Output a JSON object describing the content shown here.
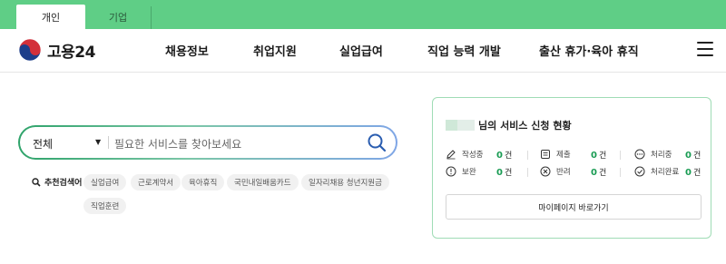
{
  "top_tabs": [
    {
      "label": "개인",
      "active": true
    },
    {
      "label": "기업",
      "active": false
    }
  ],
  "header": {
    "logo_text": "고용24",
    "nav": [
      "채용정보",
      "취업지원",
      "실업급여",
      "직업 능력 개발",
      "출산 휴가·육아 휴직"
    ],
    "menu_icon": "hamburger-icon"
  },
  "search": {
    "category": "전체",
    "placeholder": "필요한 서비스를 찾아보세요",
    "icon": "search-icon"
  },
  "recommended": {
    "label": "추천검색어",
    "chips": [
      "실업급여",
      "근로계약서",
      "육아휴직",
      "국민내일배움카드",
      "일자리채용 청년지원금",
      "직업훈련"
    ]
  },
  "status_card": {
    "title_suffix": "님의 서비스 신청 현황",
    "stats": [
      {
        "label": "작성중",
        "count": "0",
        "unit": "건",
        "icon": "pencil-icon"
      },
      {
        "label": "제출",
        "count": "0",
        "unit": "건",
        "icon": "document-icon"
      },
      {
        "label": "처리중",
        "count": "0",
        "unit": "건",
        "icon": "processing-icon"
      },
      {
        "label": "보완",
        "count": "0",
        "unit": "건",
        "icon": "alert-icon"
      },
      {
        "label": "반려",
        "count": "0",
        "unit": "건",
        "icon": "reject-icon"
      },
      {
        "label": "처리완료",
        "count": "0",
        "unit": "건",
        "icon": "check-icon"
      }
    ],
    "button_label": "마이페이지 바로가기"
  },
  "colors": {
    "topbar": "#5fce86",
    "accent_green": "#1a9c54",
    "card_border": "#9fdcb5"
  }
}
